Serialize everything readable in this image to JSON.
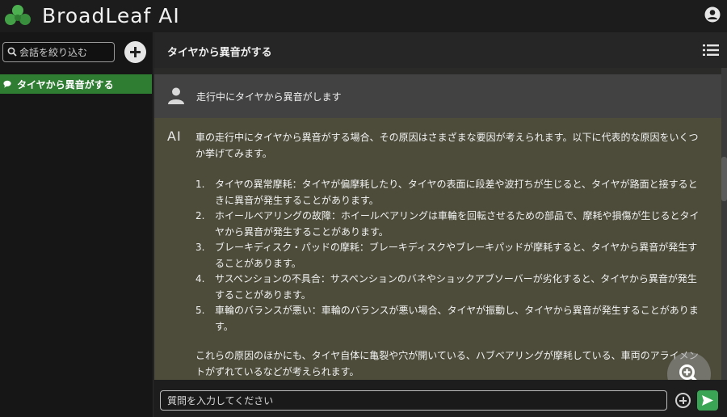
{
  "app": {
    "brand_name": "BroadLeaf AI",
    "accent_color": "#2e7d32",
    "logo_color": "#4caf50"
  },
  "sidebar": {
    "search_placeholder": "会話を絞り込む",
    "conversations": [
      {
        "label": "タイヤから異音がする",
        "selected": true
      }
    ]
  },
  "conversation": {
    "title": "タイヤから異音がする",
    "user_label": "",
    "user_message": "走行中にタイヤから異音がします",
    "ai_label": "AI",
    "ai_intro": "車の走行中にタイヤから異音がする場合、その原因はさまざまな要因が考えられます。以下に代表的な原因をいくつか挙げてみます。",
    "ai_list": [
      {
        "num": "1.",
        "text": "タイヤの異常摩耗：タイヤが偏摩耗したり、タイヤの表面に段差や波打ちが生じると、タイヤが路面と接するときに異音が発生することがあります。"
      },
      {
        "num": "2.",
        "text": "ホイールベアリングの故障：ホイールベアリングは車輪を回転させるための部品で、摩耗や損傷が生じるとタイヤから異音が発生することがあります。"
      },
      {
        "num": "3.",
        "text": "ブレーキディスク・パッドの摩耗：ブレーキディスクやブレーキパッドが摩耗すると、タイヤから異音が発生することがあります。"
      },
      {
        "num": "4.",
        "text": "サスペンションの不具合：サスペンションのバネやショックアブソーバーが劣化すると、タイヤから異音が発生することがあります。"
      },
      {
        "num": "5.",
        "text": "車輪のバランスが悪い：車輪のバランスが悪い場合、タイヤが振動し、タイヤから異音が発生することがあります。"
      }
    ],
    "ai_outro": "これらの原因のほかにも、タイヤ自体に亀裂や穴が開いている、ハブベアリングが摩耗している、車両のアライメントがずれているなどが考えられます。"
  },
  "composer": {
    "placeholder": "質問を入力してください"
  },
  "icons": {
    "brand_logo": "clover-leaf-icon",
    "user_account": "user-circle-icon",
    "search": "search-icon",
    "new_chat": "plus-circle-icon",
    "conversation": "chat-bubble-icon",
    "menu": "list-menu-icon",
    "user_avatar": "person-icon",
    "zoom": "zoom-in-icon",
    "attach": "plus-circle-outline-icon",
    "send": "send-icon"
  }
}
